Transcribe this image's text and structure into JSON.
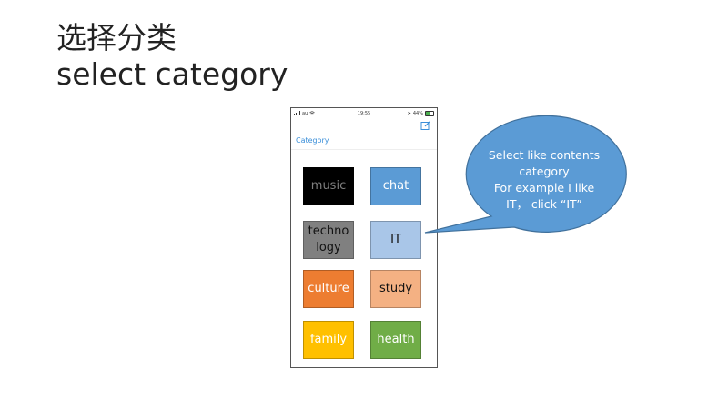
{
  "slide": {
    "title_cn": "选择分类",
    "title_en": "select category"
  },
  "phone": {
    "status_bar": {
      "carrier": "au",
      "time": "19:55",
      "battery": "44%"
    },
    "nav_title": "Category",
    "icons": {
      "edit": "edit-icon",
      "wifi": "wifi-icon",
      "battery": "battery-icon"
    },
    "categories": [
      {
        "label": "music",
        "bg": "#000000",
        "fg": "#7f7f7f"
      },
      {
        "label": "chat",
        "bg": "#5b9bd5",
        "fg": "#ffffff"
      },
      {
        "label": "techno\nlogy",
        "bg": "#808080",
        "fg": "#111111"
      },
      {
        "label": "IT",
        "bg": "#a9c6e8",
        "fg": "#111111"
      },
      {
        "label": "culture",
        "bg": "#ed7d31",
        "fg": "#ffffff"
      },
      {
        "label": "study",
        "bg": "#f4b183",
        "fg": "#111111"
      },
      {
        "label": "family",
        "bg": "#ffc000",
        "fg": "#ffffff"
      },
      {
        "label": "health",
        "bg": "#70ad47",
        "fg": "#ffffff"
      }
    ]
  },
  "callout": {
    "lines": [
      "Select like contents",
      "category",
      "For example I like",
      "IT， click “IT”"
    ],
    "color": "#5b9bd5"
  }
}
